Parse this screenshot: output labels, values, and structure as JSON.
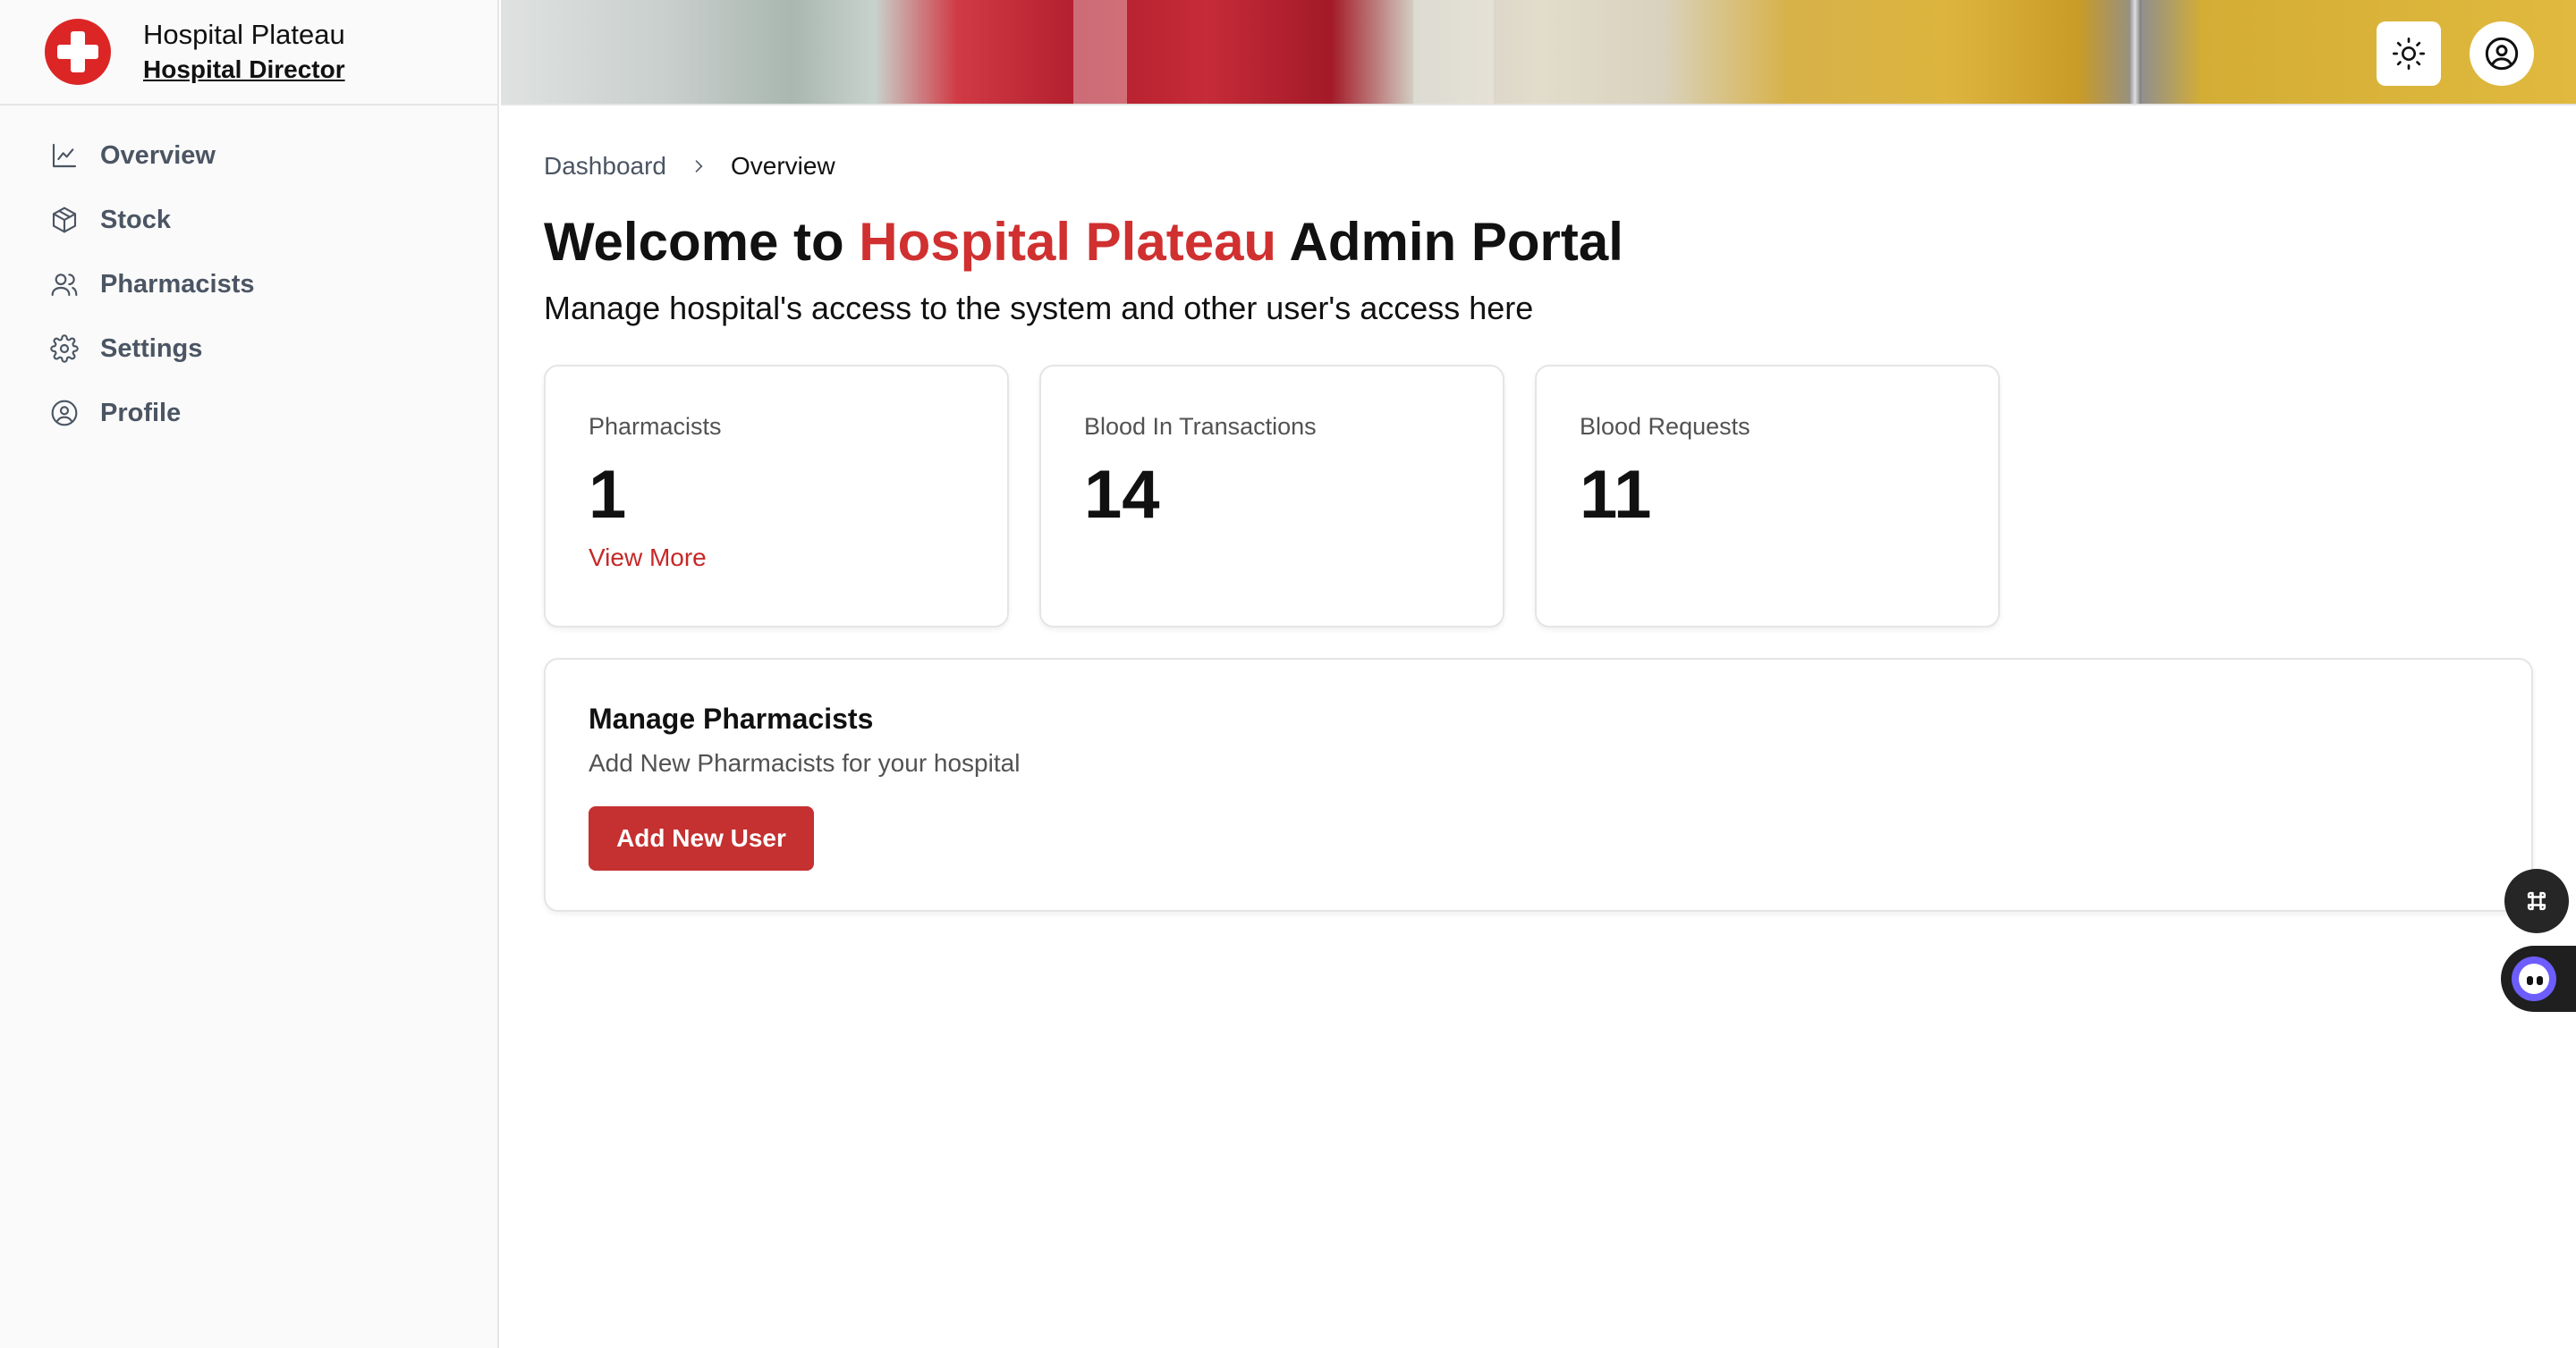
{
  "brand": {
    "name": "Hospital Plateau",
    "role": "Hospital Director",
    "logo_icon": "red-cross-icon",
    "accent_color": "#dc2626"
  },
  "sidebar": {
    "items": [
      {
        "label": "Overview",
        "icon": "line-chart-icon"
      },
      {
        "label": "Stock",
        "icon": "box-icon"
      },
      {
        "label": "Pharmacists",
        "icon": "users-icon"
      },
      {
        "label": "Settings",
        "icon": "gear-icon"
      },
      {
        "label": "Profile",
        "icon": "user-circle-icon"
      }
    ]
  },
  "header": {
    "theme_toggle_icon": "sun-icon",
    "account_icon": "user-circle-icon"
  },
  "breadcrumb": {
    "parent": "Dashboard",
    "current": "Overview"
  },
  "welcome": {
    "prefix": "Welcome to",
    "highlight": "Hospital Plateau",
    "suffix": "Admin Portal",
    "subtitle": "Manage hospital's access to the system and other user's access here"
  },
  "stats": [
    {
      "label": "Pharmacists",
      "value": "1",
      "link": "View More"
    },
    {
      "label": "Blood In Transactions",
      "value": "14"
    },
    {
      "label": "Blood Requests",
      "value": "11"
    }
  ],
  "manage": {
    "title": "Manage Pharmacists",
    "description": "Add New Pharmacists for your hospital",
    "button_label": "Add New User",
    "button_color": "#c53030"
  },
  "floating": {
    "command_icon": "command-icon",
    "assistant_icon": "assistant-bot-icon"
  }
}
